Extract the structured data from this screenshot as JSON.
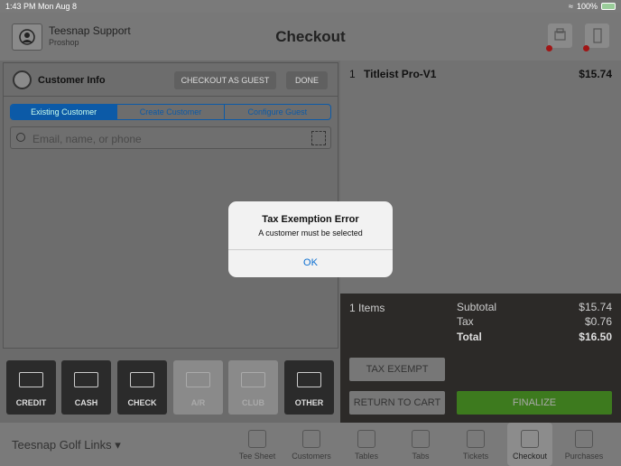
{
  "status": {
    "time": "1:43 PM",
    "date": "Mon Aug 8",
    "battery": "100%"
  },
  "header": {
    "user_name": "Teesnap Support",
    "user_role": "Proshop",
    "title": "Checkout"
  },
  "customer_info": {
    "title": "Customer Info",
    "guest_button": "CHECKOUT AS GUEST",
    "done_button": "DONE",
    "segments": [
      "Existing Customer",
      "Create Customer",
      "Configure Guest"
    ],
    "search_placeholder": "Email, name, or phone"
  },
  "payments": [
    "CREDIT",
    "CASH",
    "CHECK",
    "A/R",
    "CLUB",
    "OTHER"
  ],
  "cart": {
    "qty": "1",
    "name": "Titleist Pro-V1",
    "price": "$15.74"
  },
  "totals": {
    "items": "1 Items",
    "subtotal_label": "Subtotal",
    "subtotal": "$15.74",
    "tax_label": "Tax",
    "tax": "$0.76",
    "total_label": "Total",
    "total": "$16.50",
    "tax_exempt": "TAX EXEMPT",
    "return_to_cart": "RETURN TO CART",
    "finalize": "FINALIZE"
  },
  "footer": {
    "course": "Teesnap Golf Links",
    "tabs": [
      "Tee Sheet",
      "Customers",
      "Tables",
      "Tabs",
      "Tickets",
      "Checkout",
      "Purchases"
    ]
  },
  "dialog": {
    "title": "Tax Exemption Error",
    "message": "A customer must be selected",
    "ok": "OK"
  }
}
